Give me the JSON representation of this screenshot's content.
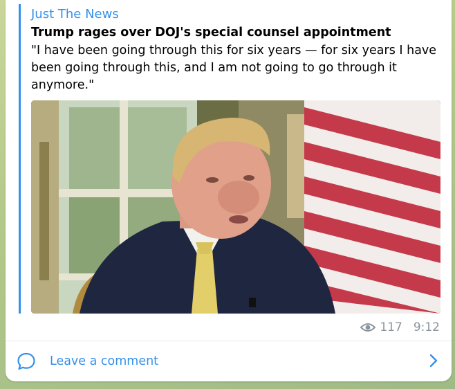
{
  "post": {
    "source": "Just The News",
    "title": "Trump rages over DOJ's special counsel appointment",
    "description": "\"I have been going through this for six years — for six years I have been going through this, and I am not going to go through it anymore.\"",
    "views": "117",
    "time": "9:12"
  },
  "comments": {
    "label": "Leave a comment"
  },
  "icons": {
    "views": "eye-icon",
    "comment": "speech-bubble-icon",
    "open": "chevron-right-icon"
  },
  "colors": {
    "accent": "#3390ec",
    "meta": "#8a949c",
    "background": "#b3c987"
  }
}
